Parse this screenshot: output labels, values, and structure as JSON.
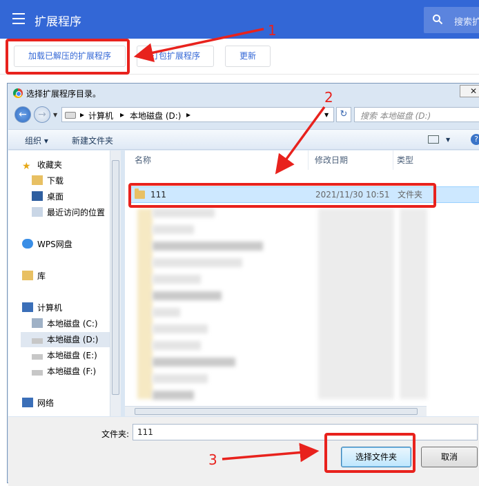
{
  "chrome": {
    "page_title": "扩展程序",
    "search_text": "搜索扩",
    "buttons": {
      "load_unpacked": "加载已解压的扩展程序",
      "pack": "打包扩展程序",
      "update": "更新"
    }
  },
  "annotations": {
    "step1": "1",
    "step2": "2",
    "step3": "3",
    "accent_color": "#e8221d"
  },
  "dialog": {
    "title": "选择扩展程序目录。",
    "breadcrumb": [
      "计算机",
      "本地磁盘 (D:)"
    ],
    "search_placeholder": "搜索 本地磁盘 (D:)",
    "commands": {
      "organize": "组织 ▾",
      "new_folder": "新建文件夹"
    },
    "nav": {
      "favorites": "收藏夹",
      "downloads": "下载",
      "desktop": "桌面",
      "recent": "最近访问的位置",
      "wps": "WPS网盘",
      "libraries": "库",
      "computer": "计算机",
      "disk_c": "本地磁盘 (C:)",
      "disk_d": "本地磁盘 (D:)",
      "disk_e": "本地磁盘 (E:)",
      "disk_f": "本地磁盘 (F:)",
      "network": "网络"
    },
    "columns": {
      "name": "名称",
      "modified": "修改日期",
      "type": "类型"
    },
    "selected_row": {
      "name": "111",
      "modified": "2021/11/30 10:51",
      "type": "文件夹"
    },
    "filename_label": "文件夹:",
    "filename_value": "111",
    "select_button": "选择文件夹",
    "cancel_button": "取消",
    "close_glyph": "✕"
  }
}
